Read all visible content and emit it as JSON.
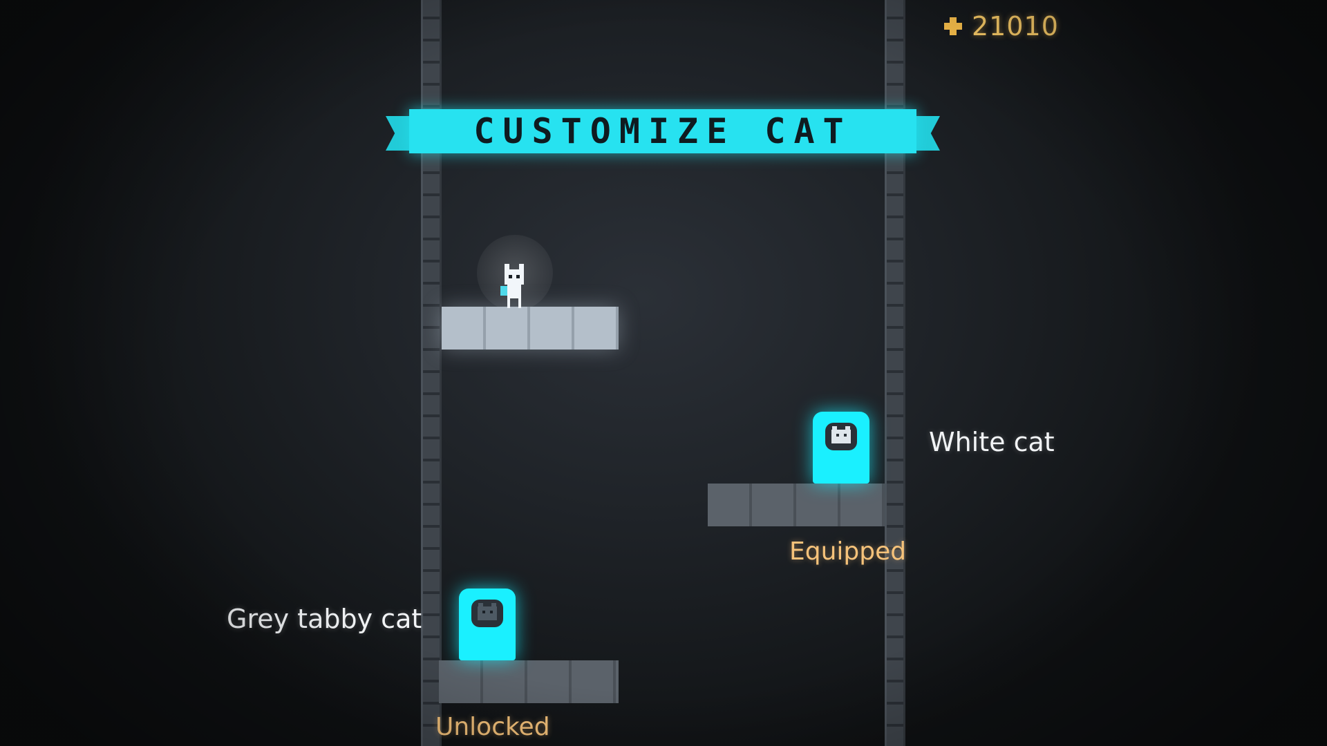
{
  "hud": {
    "coins": "21010",
    "coin_icon": "coin-icon"
  },
  "banner": {
    "title": "CUSTOMIZE CAT",
    "color": "#27e2f0"
  },
  "skins": [
    {
      "name": "White cat",
      "status": "Equipped",
      "icon": "white-cat-face-icon"
    },
    {
      "name": "Grey tabby cat",
      "status": "Unlocked",
      "icon": "grey-tabby-cat-face-icon"
    }
  ],
  "colors": {
    "accent": "#1af0ff",
    "status": "#f5c27a",
    "coins": "#ffd06a"
  }
}
